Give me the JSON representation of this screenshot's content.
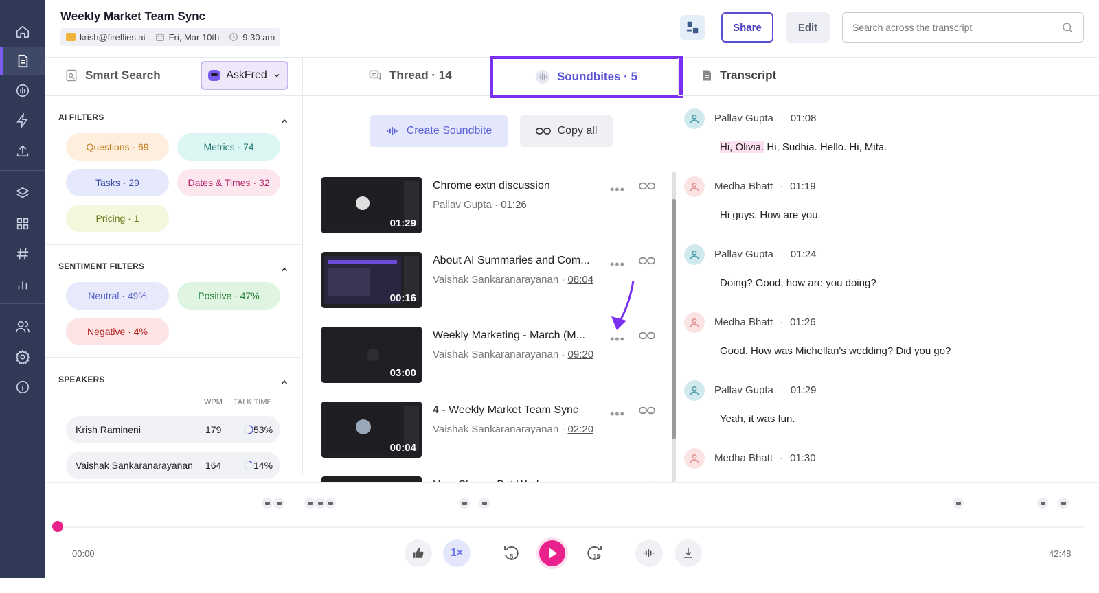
{
  "header": {
    "title": "Weekly Market Team Sync",
    "email": "krish@fireflies.ai",
    "date": "Fri, Mar 10th",
    "time": "9:30 am",
    "share_label": "Share",
    "edit_label": "Edit",
    "search_placeholder": "Search across the transcript"
  },
  "left_panel": {
    "smart_search_label": "Smart Search",
    "askfred_label": "AskFred",
    "ai_filters_title": "AI FILTERS",
    "ai_filters": [
      {
        "label": "Questions · 69",
        "bg": "#fdeedd",
        "color": "#c67a1a"
      },
      {
        "label": "Metrics · 74",
        "bg": "#dcf6f4",
        "color": "#2b7a76"
      },
      {
        "label": "Tasks · 29",
        "bg": "#e6e9fb",
        "color": "#3a49a8"
      },
      {
        "label": "Dates & Times · 32",
        "bg": "#fde7ef",
        "color": "#b2246a"
      },
      {
        "label": "Pricing · 1",
        "bg": "#f3f7dc",
        "color": "#6b7a1c"
      }
    ],
    "sentiment_title": "SENTIMENT FILTERS",
    "sentiment_filters": [
      {
        "label": "Neutral · 49%",
        "bg": "#e8e9fb",
        "color": "#5a62c8"
      },
      {
        "label": "Positive · 47%",
        "bg": "#e0f4e2",
        "color": "#1f7a2d"
      },
      {
        "label": "Negative · 4%",
        "bg": "#fde4e4",
        "color": "#b51f1f"
      }
    ],
    "speakers_title": "SPEAKERS",
    "wpm_label": "WPM",
    "talk_time_label": "TALK TIME",
    "speakers": [
      {
        "name": "Krish Ramineni",
        "wpm": "179",
        "talk": "53%"
      },
      {
        "name": "Vaishak Sankaranarayanan",
        "wpm": "164",
        "talk": "14%"
      }
    ]
  },
  "middle_panel": {
    "thread_tab": "Thread · 14",
    "soundbites_tab": "Soundbites · 5",
    "create_label": "Create Soundbite",
    "copy_label": "Copy all",
    "clips": [
      {
        "title": "Chrome extn discussion",
        "speaker": "Pallav Gupta ·",
        "time": "01:26",
        "duration": "01:29"
      },
      {
        "title": "About AI Summaries and Com...",
        "speaker": "Vaishak Sankaranarayanan ·",
        "time": "08:04",
        "duration": "00:16"
      },
      {
        "title": "Weekly Marketing - March (M...",
        "speaker": "Vaishak Sankaranarayanan ·",
        "time": "09:20",
        "duration": "03:00"
      },
      {
        "title": "4 - Weekly Market Team Sync",
        "speaker": "Vaishak Sankaranarayanan ·",
        "time": "02:20",
        "duration": "00:04"
      },
      {
        "title": "How ChromeBot Works",
        "speaker": "",
        "time": "",
        "duration": ""
      }
    ]
  },
  "transcript": {
    "title": "Transcript",
    "entries": [
      {
        "speaker": "Pallav Gupta",
        "time": "01:08",
        "highlight": "Hi, Olivia.",
        "text": " Hi, Sudhia. Hello. Hi, Mita.",
        "color": "blue"
      },
      {
        "speaker": "Medha Bhatt",
        "time": "01:19",
        "highlight": "",
        "text": "Hi guys. How are you.",
        "color": "pink"
      },
      {
        "speaker": "Pallav Gupta",
        "time": "01:24",
        "highlight": "",
        "text": "Doing? Good, how are you doing?",
        "color": "blue"
      },
      {
        "speaker": "Medha Bhatt",
        "time": "01:26",
        "highlight": "",
        "text": "Good. How was Michellan's wedding? Did you go?",
        "color": "pink"
      },
      {
        "speaker": "Pallav Gupta",
        "time": "01:29",
        "highlight": "",
        "text": "Yeah, it was fun.",
        "color": "blue"
      },
      {
        "speaker": "Medha Bhatt",
        "time": "01:30",
        "highlight": "",
        "text": "",
        "color": "pink"
      }
    ]
  },
  "player": {
    "current_time": "00:00",
    "total_time": "42:48",
    "speed_label": "1×",
    "rewind_label": "5",
    "forward_label": "15",
    "progress": 0.0
  },
  "colors": {
    "accent": "#7b5cf0",
    "play": "#e8218c",
    "nav_bg": "#303a57"
  }
}
